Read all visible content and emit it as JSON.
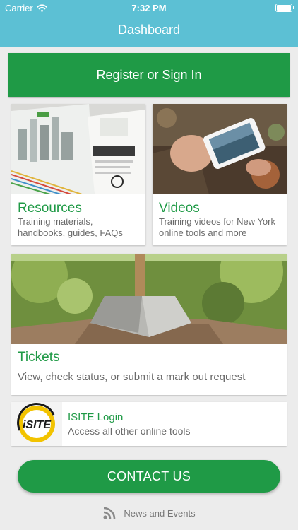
{
  "status_bar": {
    "carrier": "Carrier",
    "time": "7:32 PM"
  },
  "nav": {
    "title": "Dashboard"
  },
  "register": {
    "label": "Register or Sign In"
  },
  "cards": {
    "resources": {
      "title": "Resources",
      "description": "Training materials, handbooks, guides, FAQs"
    },
    "videos": {
      "title": "Videos",
      "description": "Training videos for New York online tools and more"
    },
    "tickets": {
      "title": "Tickets",
      "description": "View, check status, or submit a mark out request"
    },
    "isite": {
      "title": "ISITE Login",
      "description": "Access all other online tools",
      "logo_text": "iSITE"
    }
  },
  "contact": {
    "label": "CONTACT US"
  },
  "news": {
    "label": "News and Events",
    "icon": "rss-icon"
  },
  "colors": {
    "header": "#5cc0d4",
    "brand_green": "#1f9a46",
    "background": "#ececec",
    "logo_yellow": "#f2c300"
  }
}
